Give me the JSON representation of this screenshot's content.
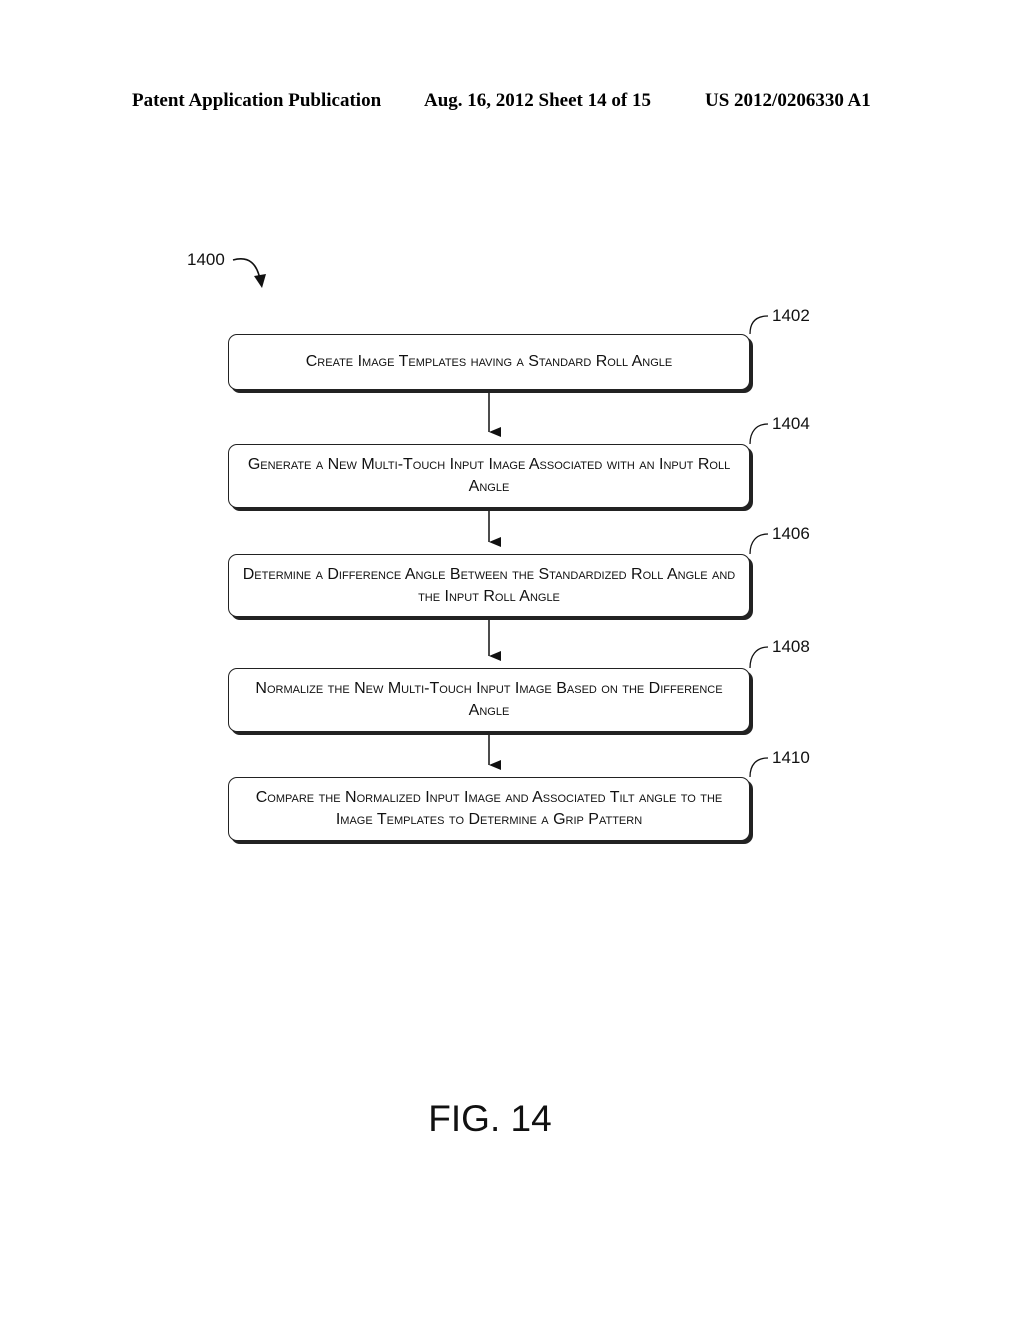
{
  "header": {
    "publication": "Patent Application Publication",
    "date_sheet": "Aug. 16, 2012  Sheet 14 of 15",
    "number": "US 2012/0206330 A1"
  },
  "diagram": {
    "ref": "1400",
    "steps": [
      {
        "ref": "1402",
        "text": "Create Image Templates having a Standard Roll Angle"
      },
      {
        "ref": "1404",
        "text": "Generate a New Multi-Touch Input Image Associated with an Input Roll Angle"
      },
      {
        "ref": "1406",
        "text": "Determine a Difference Angle Between the Standardized Roll Angle and the Input Roll Angle"
      },
      {
        "ref": "1408",
        "text": "Normalize the New Multi-Touch Input Image Based on the Difference Angle"
      },
      {
        "ref": "1410",
        "text": "Compare the Normalized Input Image  and Associated Tilt angle to the Image Templates to Determine a Grip Pattern"
      }
    ]
  },
  "figure_label": "FIG. 14"
}
